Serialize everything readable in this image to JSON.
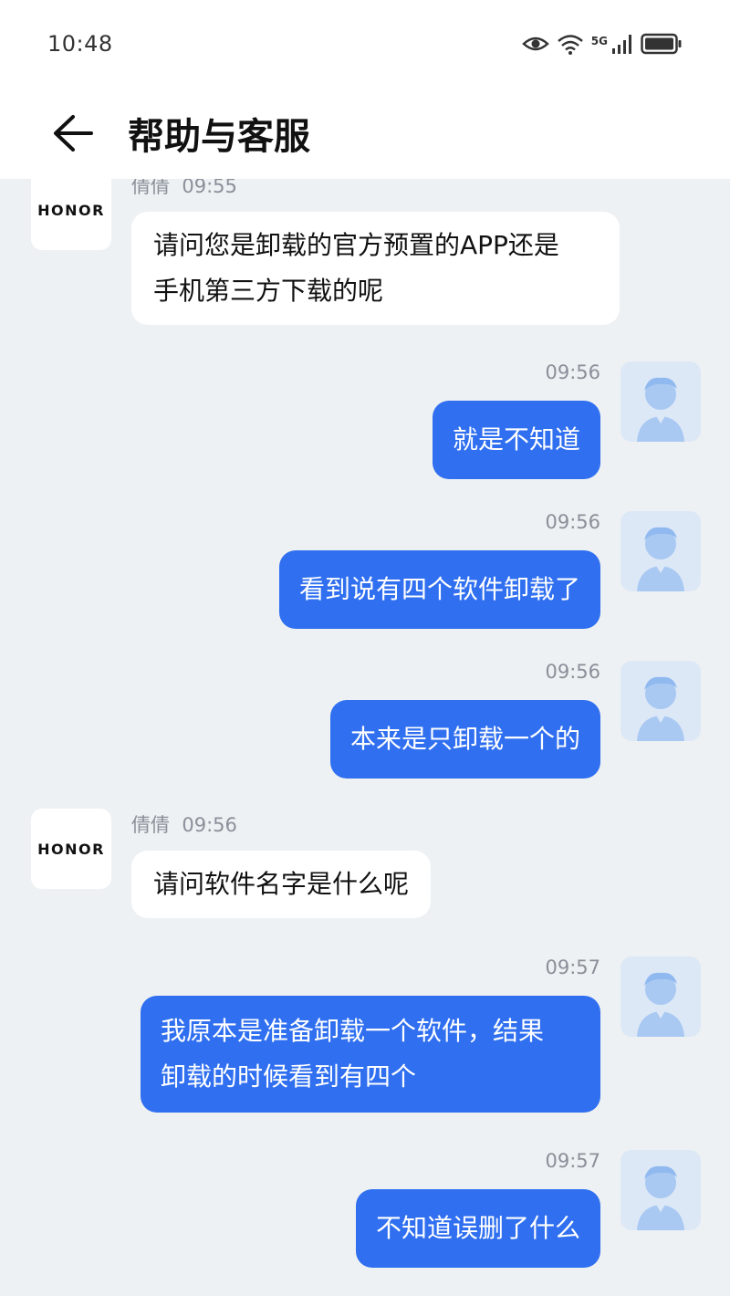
{
  "status": {
    "time": "10:48",
    "network": "5G"
  },
  "header": {
    "title": "帮助与客服"
  },
  "agent": {
    "brand": "HONOR",
    "name": "倩倩"
  },
  "messages": [
    {
      "sender": "agent",
      "time": "09:55",
      "lines": [
        "请问您是卸载的官方预置的APP还是",
        "手机第三方下载的呢"
      ]
    },
    {
      "sender": "user",
      "time": "09:56",
      "lines": [
        "就是不知道"
      ]
    },
    {
      "sender": "user",
      "time": "09:56",
      "lines": [
        "看到说有四个软件卸载了"
      ]
    },
    {
      "sender": "user",
      "time": "09:56",
      "lines": [
        "本来是只卸载一个的"
      ]
    },
    {
      "sender": "agent",
      "time": "09:56",
      "lines": [
        "请问软件名字是什么呢"
      ]
    },
    {
      "sender": "user",
      "time": "09:57",
      "lines": [
        "我原本是准备卸载一个软件，结果",
        "卸载的时候看到有四个"
      ]
    },
    {
      "sender": "user",
      "time": "09:57",
      "lines": [
        "不知道误删了什么"
      ]
    }
  ],
  "colors": {
    "user_bubble": "#2f6ff0",
    "background": "#eef1f3"
  }
}
